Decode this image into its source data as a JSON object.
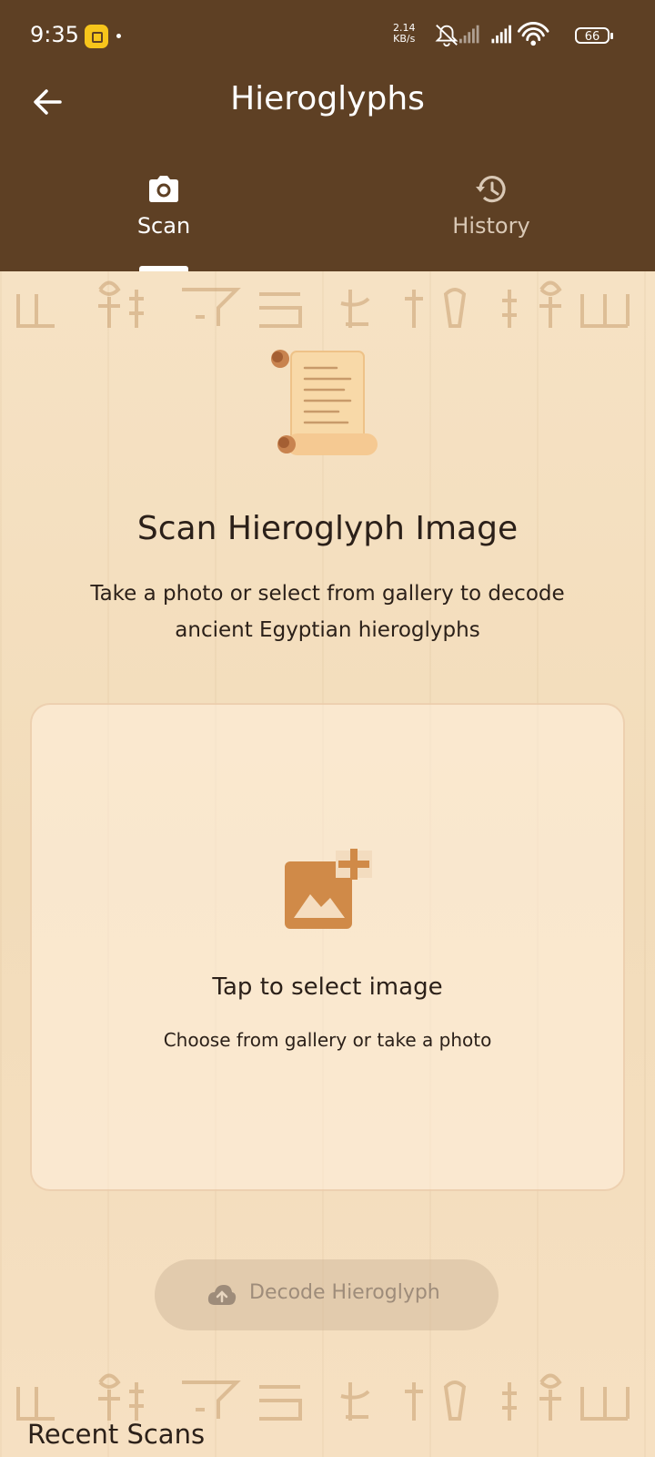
{
  "status_bar": {
    "time": "9:35",
    "net_speed_value": "2.14",
    "net_speed_unit": "KB/s",
    "battery": "66"
  },
  "header": {
    "back_icon": "arrow-left-icon",
    "title": "Hieroglyphs"
  },
  "tabs": [
    {
      "label": "Scan",
      "icon": "camera-icon",
      "selected": true
    },
    {
      "label": "History",
      "icon": "history-icon",
      "selected": false
    }
  ],
  "main": {
    "illustration": "papyrus-scroll-icon",
    "heading": "Scan Hieroglyph Image",
    "subtext": "Take a photo or select from gallery to decode ancient Egyptian hieroglyphs",
    "picker": {
      "icon": "add-photo-icon",
      "title": "Tap to select image",
      "subtitle": "Choose from gallery or take a photo"
    },
    "decode_button": {
      "icon": "cloud-upload-icon",
      "label": "Decode Hieroglyph",
      "enabled": false
    },
    "recent_title": "Recent Scans"
  },
  "colors": {
    "app_bar": "#5e4024",
    "background": "#f4dfc0",
    "accent": "#d08a48",
    "text": "#2b2019"
  }
}
